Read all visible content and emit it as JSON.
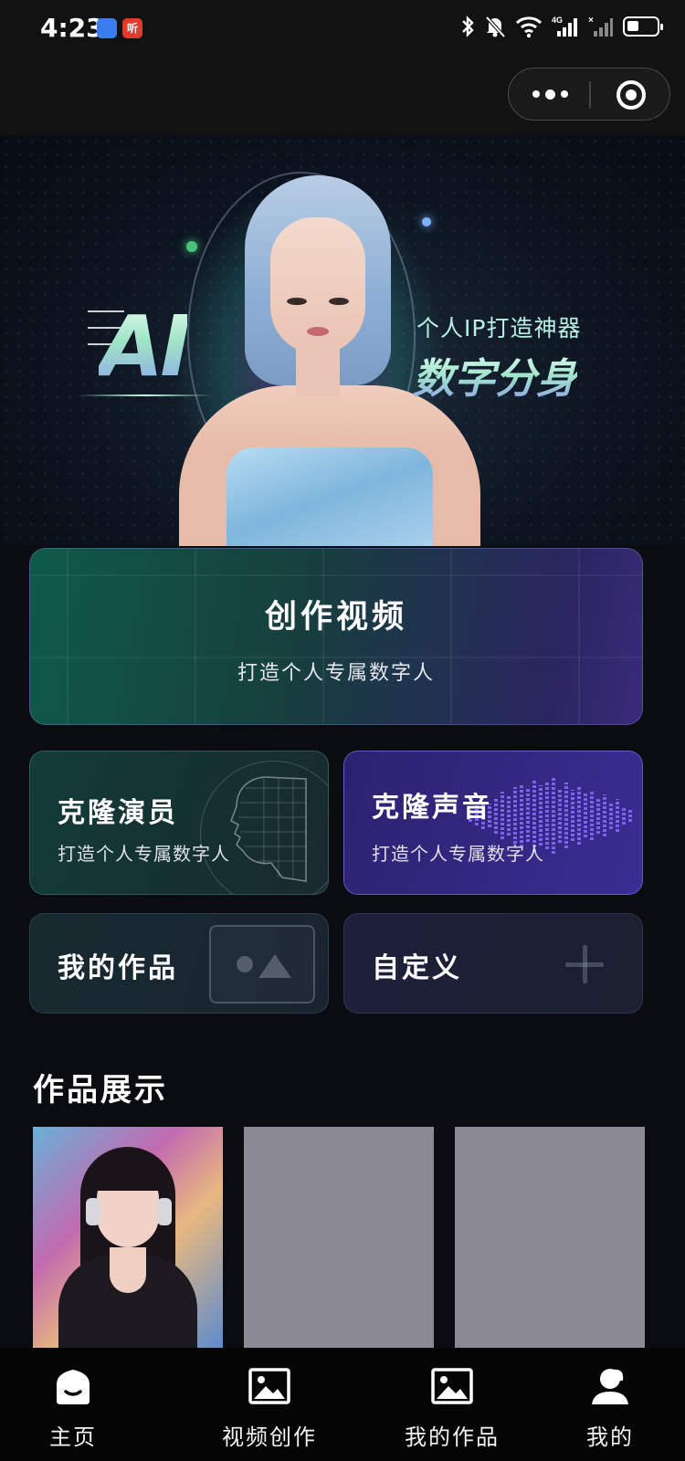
{
  "status_bar": {
    "time": "4:23",
    "badge_text": "听",
    "network": "4G"
  },
  "hero": {
    "ai_text": "AI",
    "tagline": "个人IP打造神器",
    "title": "数字分身"
  },
  "create_card": {
    "title": "创作视频",
    "subtitle": "打造个人专属数字人"
  },
  "cards": {
    "clone_actor": {
      "title": "克隆演员",
      "subtitle": "打造个人专属数字人"
    },
    "clone_voice": {
      "title": "克隆声音",
      "subtitle": "打造个人专属数字人"
    },
    "my_works": {
      "title": "我的作品"
    },
    "custom": {
      "title": "自定义"
    }
  },
  "showcase": {
    "title": "作品展示"
  },
  "tabbar": {
    "items": [
      {
        "label": "主页",
        "icon": "home-icon"
      },
      {
        "label": "视频创作",
        "icon": "image-icon"
      },
      {
        "label": "我的作品",
        "icon": "image-icon"
      },
      {
        "label": "我的",
        "icon": "user-icon"
      }
    ]
  },
  "colors": {
    "background": "#0b0b12",
    "accent_green": "#0e5a48",
    "accent_purple": "#3a2c92",
    "placeholder_gray": "#8b8a94"
  }
}
